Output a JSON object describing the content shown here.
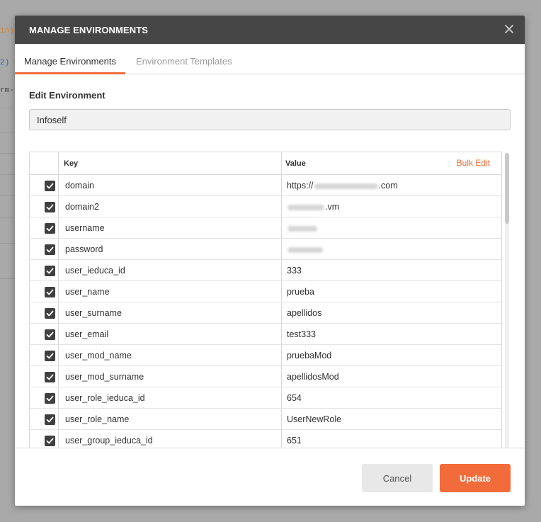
{
  "background": {
    "fragments": [
      "in))",
      "2)",
      "rm-"
    ],
    "colors": {
      "orange": "#d4822a",
      "blue": "#3b65b0",
      "dark": "#444444"
    }
  },
  "modal": {
    "title": "MANAGE ENVIRONMENTS",
    "close_icon": "close-icon",
    "tabs": [
      {
        "label": "Manage Environments",
        "active": true
      },
      {
        "label": "Environment Templates",
        "active": false
      }
    ],
    "section_label": "Edit Environment",
    "environment_name": "Infoself",
    "table": {
      "headers": {
        "key": "Key",
        "value": "Value",
        "bulk_edit": "Bulk Edit"
      },
      "rows": [
        {
          "checked": true,
          "key": "domain",
          "value_prefix": "https://",
          "value_suffix": ".com",
          "blurred": true
        },
        {
          "checked": true,
          "key": "domain2",
          "value_prefix": "",
          "value_suffix": ".vm",
          "blurred": true
        },
        {
          "checked": true,
          "key": "username",
          "value_prefix": "",
          "value_suffix": "",
          "blurred": true
        },
        {
          "checked": true,
          "key": "password",
          "value_prefix": "",
          "value_suffix": "",
          "blurred": true
        },
        {
          "checked": true,
          "key": "user_ieduca_id",
          "value": "333"
        },
        {
          "checked": true,
          "key": "user_name",
          "value": "prueba"
        },
        {
          "checked": true,
          "key": "user_surname",
          "value": "apellidos"
        },
        {
          "checked": true,
          "key": "user_email",
          "value": "test333"
        },
        {
          "checked": true,
          "key": "user_mod_name",
          "value": "pruebaMod"
        },
        {
          "checked": true,
          "key": "user_mod_surname",
          "value": "apellidosMod"
        },
        {
          "checked": true,
          "key": "user_role_ieduca_id",
          "value": "654"
        },
        {
          "checked": true,
          "key": "user_role_name",
          "value": "UserNewRole"
        },
        {
          "checked": true,
          "key": "user_group_ieduca_id",
          "value": "651"
        }
      ]
    },
    "buttons": {
      "cancel": "Cancel",
      "update": "Update"
    },
    "colors": {
      "header_bg": "#464646",
      "accent": "#f26b3a",
      "checkbox": "#3f3f3f"
    }
  }
}
